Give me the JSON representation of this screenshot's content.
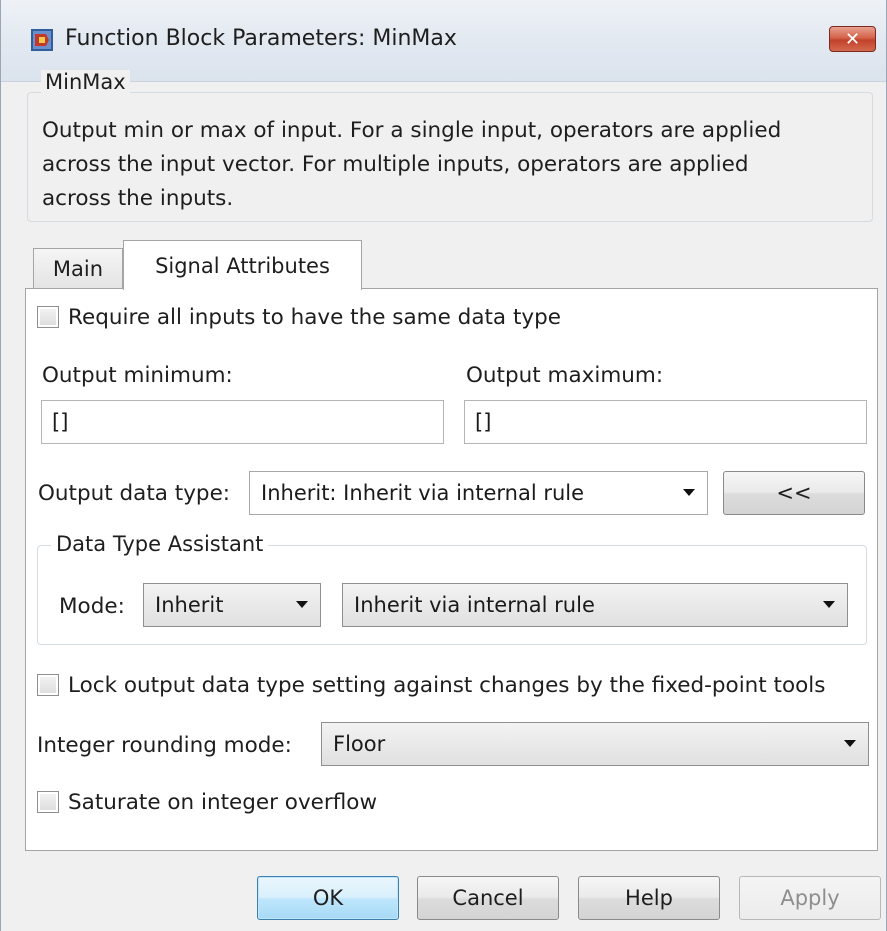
{
  "window": {
    "title": "Function Block Parameters: MinMax",
    "close_glyph": "✕"
  },
  "description": {
    "group_title": "MinMax",
    "lines": [
      "Output min or max of input.  For a single input, operators are applied",
      "across the input vector.  For multiple inputs, operators are applied",
      "across the inputs."
    ]
  },
  "tabs": [
    {
      "label": "Main",
      "active": false
    },
    {
      "label": "Signal Attributes",
      "active": true
    }
  ],
  "signal_attributes": {
    "require_same_type": {
      "label": "Require all inputs to have the same data type",
      "checked": false
    },
    "output_minimum": {
      "label": "Output minimum:",
      "value": "[]"
    },
    "output_maximum": {
      "label": "Output maximum:",
      "value": "[]"
    },
    "output_data_type": {
      "label": "Output data type:",
      "value": "Inherit: Inherit via internal rule",
      "toggle_button": "<<"
    },
    "data_type_assistant": {
      "title": "Data Type Assistant",
      "mode_label": "Mode:",
      "mode_value": "Inherit",
      "rule_value": "Inherit via internal rule"
    },
    "lock_output": {
      "label": "Lock output data type setting against changes by the fixed-point tools",
      "checked": false
    },
    "integer_rounding": {
      "label": "Integer rounding mode:",
      "value": "Floor"
    },
    "saturate": {
      "label": "Saturate on integer overflow",
      "checked": false
    }
  },
  "buttons": {
    "ok": "OK",
    "cancel": "Cancel",
    "help": "Help",
    "apply": "Apply"
  },
  "colors": {
    "accent_default_button": "#3c7fb1",
    "close_button": "#c1412a"
  }
}
